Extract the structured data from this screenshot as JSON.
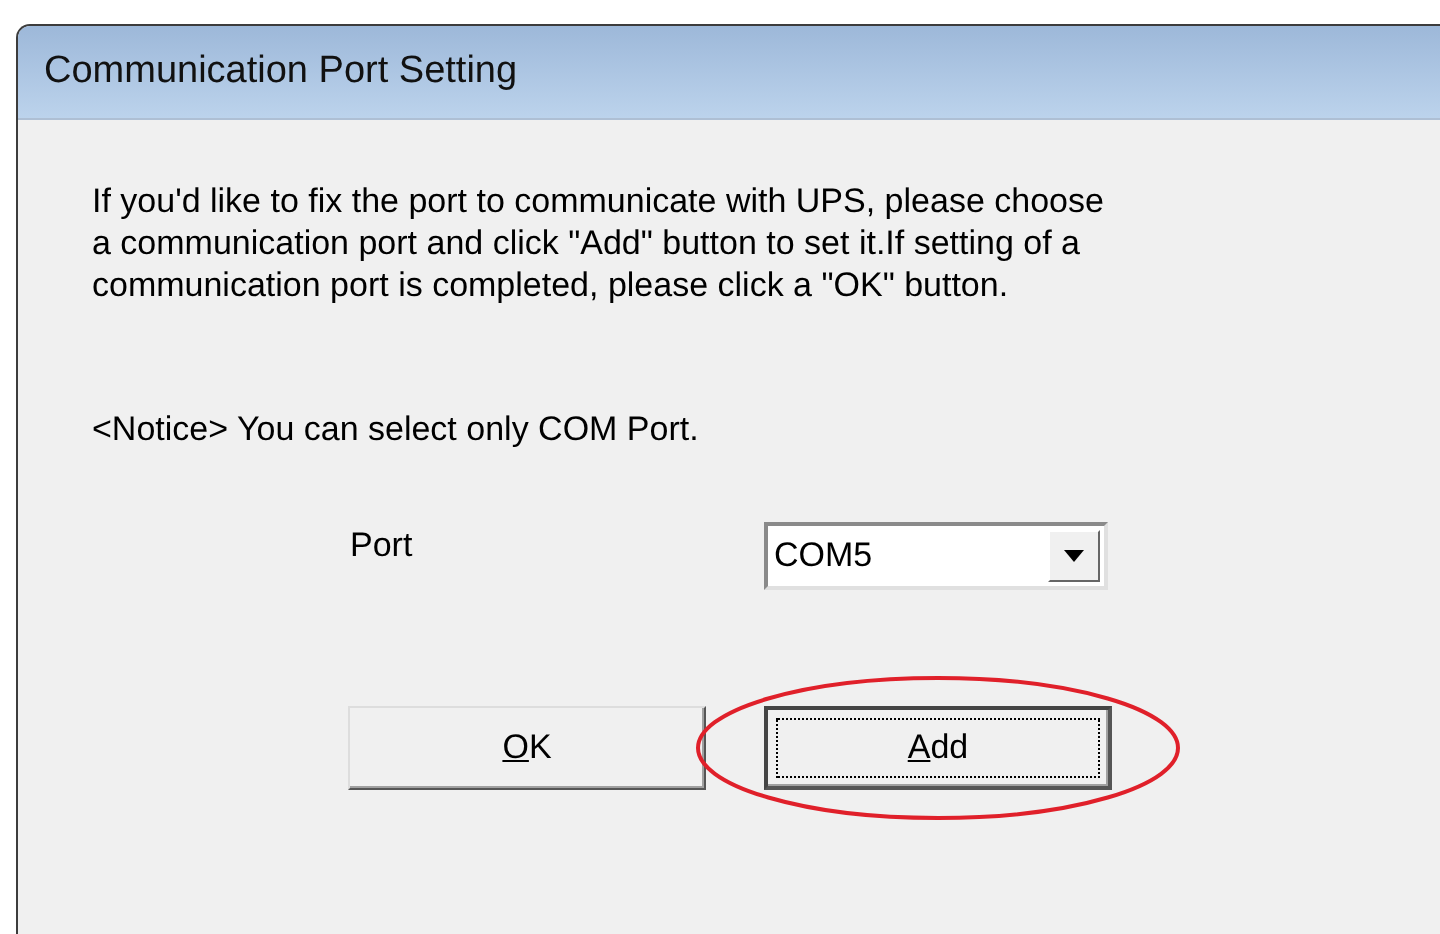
{
  "window": {
    "title": "Communication Port Setting"
  },
  "message_lines": [
    "If you'd like to fix the port to communicate with UPS, please choose",
    "a communication port and click \"Add\" button to set it.If setting of a",
    "communication port is completed, please click a \"OK\" button."
  ],
  "notice": "<Notice> You can select only COM Port.",
  "port": {
    "label": "Port",
    "value": "COM5"
  },
  "buttons": [
    {
      "label": "OK",
      "focused": false,
      "annotated": false
    },
    {
      "label": "Add",
      "focused": true,
      "annotated": true
    }
  ]
}
